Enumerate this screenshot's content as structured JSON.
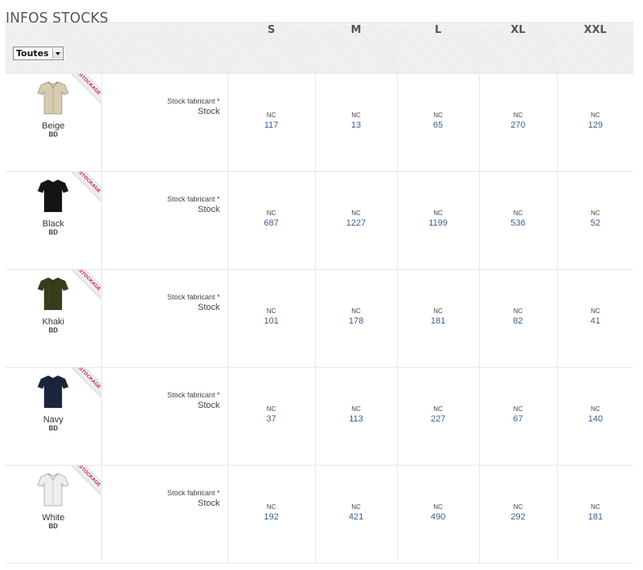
{
  "page": {
    "title": "INFOS STOCKS"
  },
  "filter": {
    "selected": "Toutes"
  },
  "sizes": [
    "S",
    "M",
    "L",
    "XL",
    "XXL"
  ],
  "labels": {
    "manufacturer": "Stock fabricant *",
    "stock": "Stock",
    "badge": "DÉSTOCKAGE"
  },
  "colors": {
    "link": "#3b5e8c",
    "badge": "#c8102e"
  },
  "rows": [
    {
      "color": "Beige",
      "code": "BD",
      "swatch": "#d8ccb0",
      "manufacturer": [
        "NC",
        "NC",
        "NC",
        "NC",
        "NC"
      ],
      "stock": [
        "117",
        "13",
        "65",
        "270",
        "129"
      ]
    },
    {
      "color": "Black",
      "code": "BD",
      "swatch": "#141414",
      "manufacturer": [
        "NC",
        "NC",
        "NC",
        "NC",
        "NC"
      ],
      "stock": [
        "687",
        "1227",
        "1199",
        "536",
        "52"
      ]
    },
    {
      "color": "Khaki",
      "code": "BD",
      "swatch": "#3a3d1c",
      "manufacturer": [
        "NC",
        "NC",
        "NC",
        "NC",
        "NC"
      ],
      "stock": [
        "101",
        "178",
        "181",
        "82",
        "41"
      ]
    },
    {
      "color": "Navy",
      "code": "BD",
      "swatch": "#18253d",
      "manufacturer": [
        "NC",
        "NC",
        "NC",
        "NC",
        "NC"
      ],
      "stock": [
        "37",
        "113",
        "227",
        "67",
        "140"
      ]
    },
    {
      "color": "White",
      "code": "BD",
      "swatch": "#eeeeef",
      "manufacturer": [
        "NC",
        "NC",
        "NC",
        "NC",
        "NC"
      ],
      "stock": [
        "192",
        "421",
        "490",
        "292",
        "181"
      ]
    }
  ]
}
